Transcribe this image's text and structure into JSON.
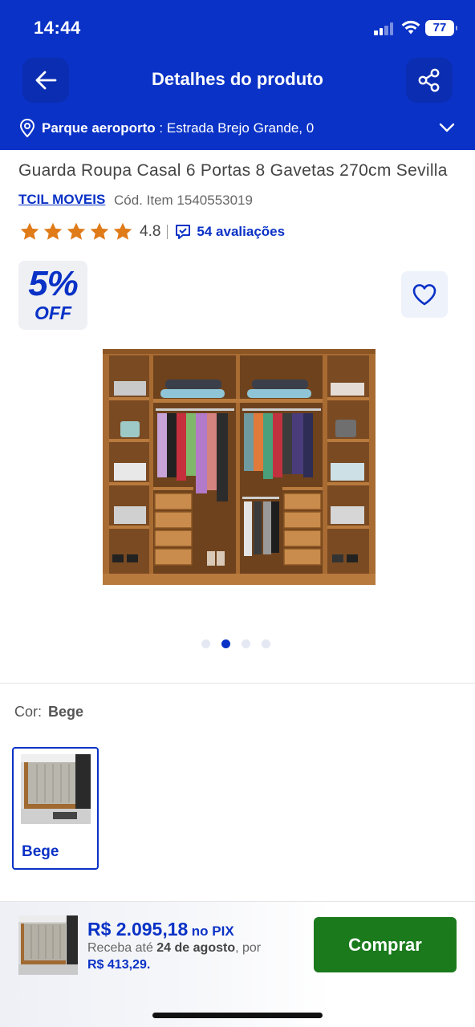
{
  "status_bar": {
    "time": "14:44",
    "battery": "77"
  },
  "nav": {
    "title": "Detalhes do produto",
    "back_icon": "arrow-left-icon",
    "share_icon": "share-icon"
  },
  "location": {
    "name": "Parque aeroporto",
    "address": " : Estrada Brejo Grande, 0"
  },
  "product": {
    "title": "Guarda Roupa Casal 6 Portas 8 Gavetas 270cm Sevilla",
    "brand": "TCIL MOVEIS",
    "code": "Cód. Item 1540553019",
    "rating": 4.8,
    "rating_label": "4.8",
    "reviews": "54 avaliações",
    "badge_pct": "5%",
    "badge_off": "OFF",
    "carousel": {
      "count": 4,
      "active_index": 1
    }
  },
  "color": {
    "label": "Cor:",
    "selected": "Bege",
    "options": [
      {
        "label": "Bege"
      }
    ]
  },
  "buy_bar": {
    "price": "R$ 2.095,18",
    "pix": "no PIX",
    "install_prefix": "Receba até ",
    "install_date": "24 de agosto",
    "install_suffix": ", por",
    "install_value": "R$ 413,29.",
    "button": "Comprar"
  },
  "colors": {
    "brand_blue": "#0a32c6",
    "buy_green": "#1a7a1c",
    "star": "#e07b1a",
    "wood": "#a86b32"
  }
}
